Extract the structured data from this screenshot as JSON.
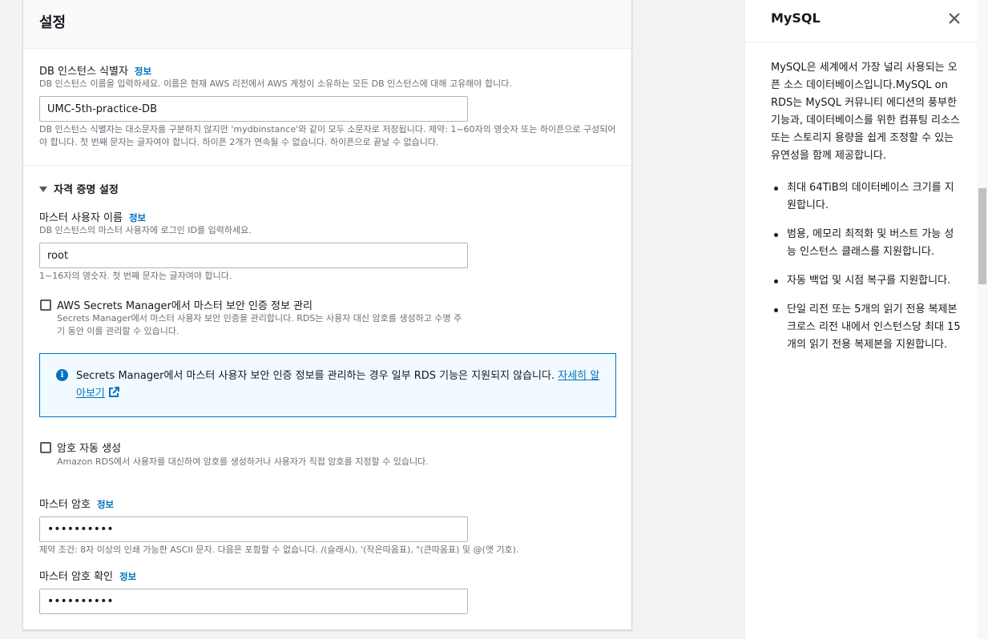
{
  "settings": {
    "title": "설정",
    "info_label": "정보",
    "db_identifier": {
      "label": "DB 인스턴스 식별자",
      "description": "DB 인스턴스 이름을 입력하세요. 이름은 현재 AWS 리전에서 AWS 계정이 소유하는 모든 DB 인스턴스에 대해 고유해야 합니다.",
      "value": "UMC-5th-practice-DB",
      "constraint": "DB 인스턴스 식별자는 대소문자를 구분하지 않지만 'mydbinstance'와 같이 모두 소문자로 저장됩니다. 제약: 1~60자의 영숫자 또는 하이픈으로 구성되어야 합니다. 첫 번째 문자는 글자여야 합니다. 하이픈 2개가 연속될 수 없습니다. 하이픈으로 끝날 수 없습니다."
    },
    "credentials": {
      "section_label": "자격 증명 설정",
      "master_username": {
        "label": "마스터 사용자 이름",
        "description": "DB 인스턴스의 마스터 사용자에 로그인 ID를 입력하세요.",
        "value": "root",
        "constraint": "1~16자의 영숫자. 첫 번째 문자는 글자여야 합니다."
      },
      "secrets_manager": {
        "label": "AWS Secrets Manager에서 마스터 보안 인증 정보 관리",
        "description": "Secrets Manager에서 마스터 사용자 보안 인증을 관리합니다. RDS는 사용자 대신 암호를 생성하고 수명 주기 동안 이를 관리할 수 있습니다.",
        "checked": false
      },
      "alert": {
        "text": "Secrets Manager에서 마스터 사용자 보안 인증 정보를 관리하는 경우 일부 RDS 기능은 지원되지 않습니다.",
        "link": "자세히 알아보기"
      },
      "auto_password": {
        "label": "암호 자동 생성",
        "description": "Amazon RDS에서 사용자를 대신하여 암호를 생성하거나 사용자가 직접 암호를 지정할 수 있습니다.",
        "checked": false
      },
      "master_password": {
        "label": "마스터 암호",
        "value": "••••••••••",
        "constraint": "제약 조건: 8자 이상의 인쇄 가능한 ASCII 문자. 다음은 포함할 수 없습니다. /(슬래시), '(작은따옴표), \"(큰따옴표) 및 @(앳 기호)."
      },
      "confirm_password": {
        "label": "마스터 암호 확인",
        "value": "••••••••••"
      }
    }
  },
  "help_panel": {
    "title": "MySQL",
    "intro": "MySQL은 세계에서 가장 널리 사용되는 오픈 소스 데이터베이스입니다.MySQL on RDS는 MySQL 커뮤니티 에디션의 풍부한 기능과, 데이터베이스를 위한 컴퓨팅 리소스 또는 스토리지 용량을 쉽게 조정할 수 있는 유연성을 함께 제공합니다.",
    "bullets": [
      "최대 64TiB의 데이터베이스 크기를 지원합니다.",
      "범용, 메모리 최적화 및 버스트 가능 성능 인스턴스 클래스를 지원합니다.",
      "자동 백업 및 시점 복구를 지원합니다.",
      "단일 리전 또는 5개의 읽기 전용 복제본 크로스 리전 내에서 인스턴스당 최대 15개의 읽기 전용 복제본을 지원합니다."
    ]
  },
  "colors": {
    "link": "#0073bb",
    "alert_bg": "#f1faff",
    "text": "#16191f",
    "muted": "#687078"
  }
}
